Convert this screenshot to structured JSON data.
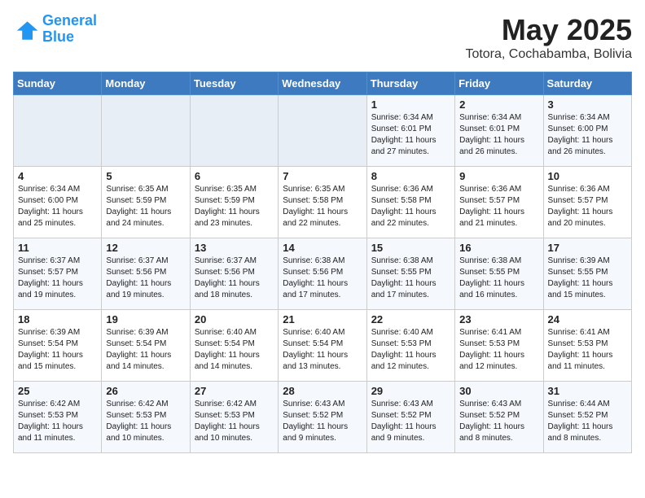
{
  "logo": {
    "line1": "General",
    "line2": "Blue"
  },
  "title": "May 2025",
  "location": "Totora, Cochabamba, Bolivia",
  "weekdays": [
    "Sunday",
    "Monday",
    "Tuesday",
    "Wednesday",
    "Thursday",
    "Friday",
    "Saturday"
  ],
  "weeks": [
    [
      {
        "day": "",
        "info": ""
      },
      {
        "day": "",
        "info": ""
      },
      {
        "day": "",
        "info": ""
      },
      {
        "day": "",
        "info": ""
      },
      {
        "day": "1",
        "info": "Sunrise: 6:34 AM\nSunset: 6:01 PM\nDaylight: 11 hours\nand 27 minutes."
      },
      {
        "day": "2",
        "info": "Sunrise: 6:34 AM\nSunset: 6:01 PM\nDaylight: 11 hours\nand 26 minutes."
      },
      {
        "day": "3",
        "info": "Sunrise: 6:34 AM\nSunset: 6:00 PM\nDaylight: 11 hours\nand 26 minutes."
      }
    ],
    [
      {
        "day": "4",
        "info": "Sunrise: 6:34 AM\nSunset: 6:00 PM\nDaylight: 11 hours\nand 25 minutes."
      },
      {
        "day": "5",
        "info": "Sunrise: 6:35 AM\nSunset: 5:59 PM\nDaylight: 11 hours\nand 24 minutes."
      },
      {
        "day": "6",
        "info": "Sunrise: 6:35 AM\nSunset: 5:59 PM\nDaylight: 11 hours\nand 23 minutes."
      },
      {
        "day": "7",
        "info": "Sunrise: 6:35 AM\nSunset: 5:58 PM\nDaylight: 11 hours\nand 22 minutes."
      },
      {
        "day": "8",
        "info": "Sunrise: 6:36 AM\nSunset: 5:58 PM\nDaylight: 11 hours\nand 22 minutes."
      },
      {
        "day": "9",
        "info": "Sunrise: 6:36 AM\nSunset: 5:57 PM\nDaylight: 11 hours\nand 21 minutes."
      },
      {
        "day": "10",
        "info": "Sunrise: 6:36 AM\nSunset: 5:57 PM\nDaylight: 11 hours\nand 20 minutes."
      }
    ],
    [
      {
        "day": "11",
        "info": "Sunrise: 6:37 AM\nSunset: 5:57 PM\nDaylight: 11 hours\nand 19 minutes."
      },
      {
        "day": "12",
        "info": "Sunrise: 6:37 AM\nSunset: 5:56 PM\nDaylight: 11 hours\nand 19 minutes."
      },
      {
        "day": "13",
        "info": "Sunrise: 6:37 AM\nSunset: 5:56 PM\nDaylight: 11 hours\nand 18 minutes."
      },
      {
        "day": "14",
        "info": "Sunrise: 6:38 AM\nSunset: 5:56 PM\nDaylight: 11 hours\nand 17 minutes."
      },
      {
        "day": "15",
        "info": "Sunrise: 6:38 AM\nSunset: 5:55 PM\nDaylight: 11 hours\nand 17 minutes."
      },
      {
        "day": "16",
        "info": "Sunrise: 6:38 AM\nSunset: 5:55 PM\nDaylight: 11 hours\nand 16 minutes."
      },
      {
        "day": "17",
        "info": "Sunrise: 6:39 AM\nSunset: 5:55 PM\nDaylight: 11 hours\nand 15 minutes."
      }
    ],
    [
      {
        "day": "18",
        "info": "Sunrise: 6:39 AM\nSunset: 5:54 PM\nDaylight: 11 hours\nand 15 minutes."
      },
      {
        "day": "19",
        "info": "Sunrise: 6:39 AM\nSunset: 5:54 PM\nDaylight: 11 hours\nand 14 minutes."
      },
      {
        "day": "20",
        "info": "Sunrise: 6:40 AM\nSunset: 5:54 PM\nDaylight: 11 hours\nand 14 minutes."
      },
      {
        "day": "21",
        "info": "Sunrise: 6:40 AM\nSunset: 5:54 PM\nDaylight: 11 hours\nand 13 minutes."
      },
      {
        "day": "22",
        "info": "Sunrise: 6:40 AM\nSunset: 5:53 PM\nDaylight: 11 hours\nand 12 minutes."
      },
      {
        "day": "23",
        "info": "Sunrise: 6:41 AM\nSunset: 5:53 PM\nDaylight: 11 hours\nand 12 minutes."
      },
      {
        "day": "24",
        "info": "Sunrise: 6:41 AM\nSunset: 5:53 PM\nDaylight: 11 hours\nand 11 minutes."
      }
    ],
    [
      {
        "day": "25",
        "info": "Sunrise: 6:42 AM\nSunset: 5:53 PM\nDaylight: 11 hours\nand 11 minutes."
      },
      {
        "day": "26",
        "info": "Sunrise: 6:42 AM\nSunset: 5:53 PM\nDaylight: 11 hours\nand 10 minutes."
      },
      {
        "day": "27",
        "info": "Sunrise: 6:42 AM\nSunset: 5:53 PM\nDaylight: 11 hours\nand 10 minutes."
      },
      {
        "day": "28",
        "info": "Sunrise: 6:43 AM\nSunset: 5:52 PM\nDaylight: 11 hours\nand 9 minutes."
      },
      {
        "day": "29",
        "info": "Sunrise: 6:43 AM\nSunset: 5:52 PM\nDaylight: 11 hours\nand 9 minutes."
      },
      {
        "day": "30",
        "info": "Sunrise: 6:43 AM\nSunset: 5:52 PM\nDaylight: 11 hours\nand 8 minutes."
      },
      {
        "day": "31",
        "info": "Sunrise: 6:44 AM\nSunset: 5:52 PM\nDaylight: 11 hours\nand 8 minutes."
      }
    ]
  ]
}
